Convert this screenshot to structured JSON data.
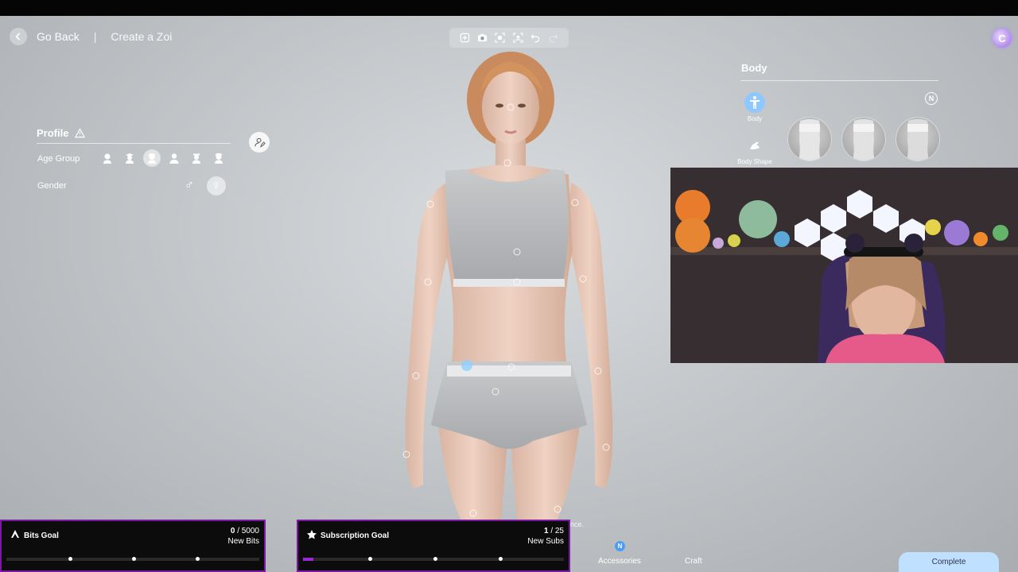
{
  "nav": {
    "back_label": "Go Back",
    "separator": "|",
    "breadcrumb": "Create a Zoi"
  },
  "toolbar": {
    "icons": [
      "add-frame-icon",
      "camera-icon",
      "screenshot-icon",
      "focus-icon",
      "undo-icon",
      "redo-icon"
    ]
  },
  "account_badge": "C",
  "profile": {
    "title": "Profile",
    "age_group_label": "Age Group",
    "gender_label": "Gender",
    "age_groups_selected_index": 2,
    "gender_selected": "female"
  },
  "body_panel": {
    "title": "Body",
    "categories": [
      {
        "label": "Body"
      },
      {
        "label": "Body Shape"
      }
    ],
    "badge": "N"
  },
  "hint_text": "nce.",
  "goals": {
    "bits": {
      "name": "Bits Goal",
      "current": "0",
      "target": "/ 5000",
      "unit": "New Bits",
      "progress": 0
    },
    "subs": {
      "name": "Subscription Goal",
      "current": "1",
      "target": "/ 25",
      "unit": "New Subs",
      "progress": 0.04
    }
  },
  "bottom_nav": {
    "accessories": "Accessories",
    "craft": "Craft",
    "badge": "N"
  },
  "complete_label": "Complete",
  "colors": {
    "accent_purple": "#7a1aa2",
    "complete_bg": "#bfe0ff",
    "selected_blue": "#8fc8ff"
  }
}
